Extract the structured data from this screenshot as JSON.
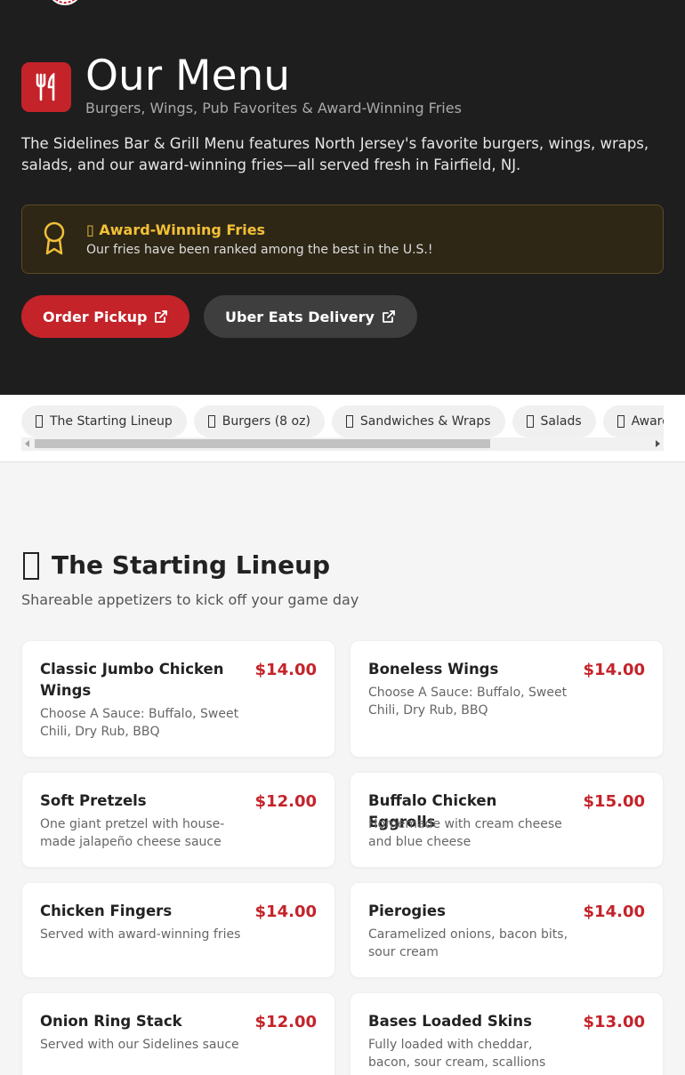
{
  "header": {
    "title": "Our Menu",
    "subtitle": "Burgers, Wings, Pub Favorites & Award-Winning Fries",
    "intro": "The Sidelines Bar & Grill Menu features North Jersey's favorite burgers, wings, wraps, salads, and our award-winning fries—all served fresh in Fairfield, NJ."
  },
  "award": {
    "title": "▯ Award-Winning Fries",
    "text": "Our fries have been ranked among the best in the U.S.!"
  },
  "buttons": {
    "pickup": "Order Pickup",
    "uber": "Uber Eats Delivery"
  },
  "tabs": [
    {
      "label": "The Starting Lineup"
    },
    {
      "label": "Burgers (8 oz)"
    },
    {
      "label": "Sandwiches & Wraps"
    },
    {
      "label": "Salads"
    },
    {
      "label": "Award-Winning Fries"
    }
  ],
  "section": {
    "title": "The Starting Lineup",
    "subtitle": "Shareable appetizers to kick off your game day"
  },
  "items": [
    {
      "name": "Classic Jumbo Chicken Wings",
      "price": "$14.00",
      "desc": "Choose A Sauce: Buffalo, Sweet Chili, Dry Rub, BBQ"
    },
    {
      "name": "Boneless Wings",
      "price": "$14.00",
      "desc": "Choose A Sauce: Buffalo, Sweet Chili, Dry Rub, BBQ"
    },
    {
      "name": "Soft Pretzels",
      "price": "$12.00",
      "desc": "One giant pretzel with house-made jalapeño cheese sauce"
    },
    {
      "name": "Buffalo Chicken Eggrolls",
      "price": "$15.00",
      "desc": "Homemade with cream cheese and blue cheese"
    },
    {
      "name": "Chicken Fingers",
      "price": "$14.00",
      "desc": "Served with award-winning fries"
    },
    {
      "name": "Pierogies",
      "price": "$14.00",
      "desc": "Caramelized onions, bacon bits, sour cream"
    },
    {
      "name": "Onion Ring Stack",
      "price": "$12.00",
      "desc": "Served with our Sidelines sauce"
    },
    {
      "name": "Bases Loaded Skins",
      "price": "$13.00",
      "desc": "Fully loaded with cheddar, bacon, sour cream, scallions"
    }
  ],
  "colors": {
    "accent": "#c4232a",
    "gold": "#f2c037",
    "hero_bg": "#1e1e1e"
  },
  "icons": {
    "title": "utensils-icon",
    "award": "award-ribbon-icon",
    "external": "external-link-icon",
    "logo": "logo-badge"
  }
}
